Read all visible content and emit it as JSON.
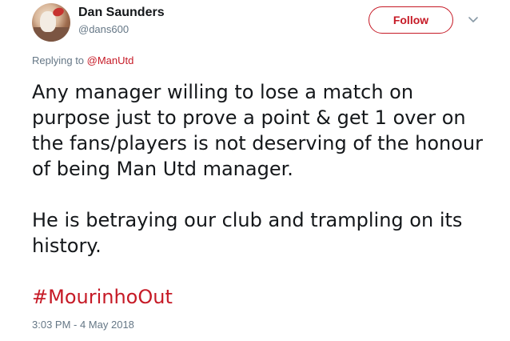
{
  "user": {
    "display_name": "Dan Saunders",
    "handle": "@dans600",
    "avatar_icon": "profile-photo"
  },
  "follow_label": "Follow",
  "menu_icon": "chevron-down-icon",
  "replying": {
    "prefix": "Replying to ",
    "mention": "@ManUtd"
  },
  "body": {
    "paragraph1": "Any manager willing to lose a match on purpose just to prove a point & get 1 over on the fans/players is not deserving of the honour of being Man Utd manager.",
    "paragraph2": "He is betraying our club and trampling on its history.",
    "hashtag": "#MourinhoOut"
  },
  "timestamp": "3:03 PM - 4 May 2018",
  "colors": {
    "accent": "#c61a26",
    "text": "#14171a",
    "muted": "#657786"
  }
}
